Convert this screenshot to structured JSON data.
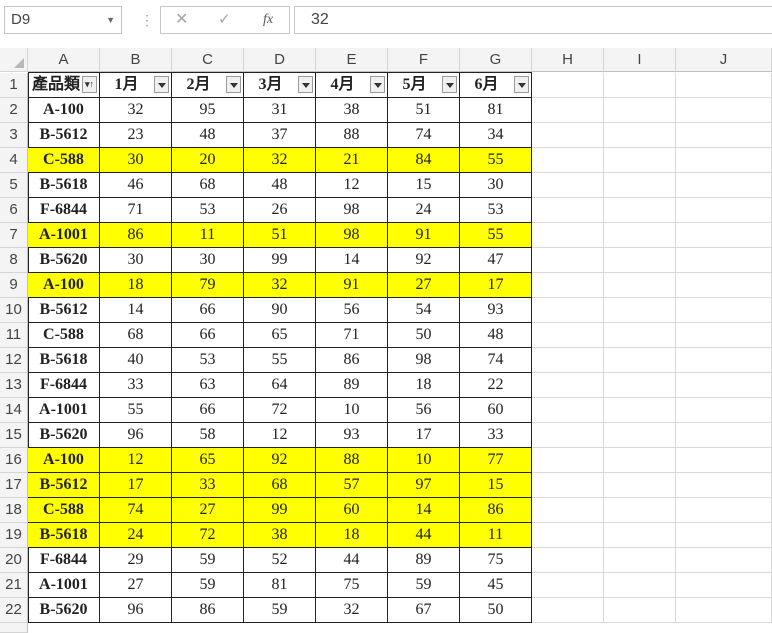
{
  "formula_bar": {
    "name_box": "D9",
    "cancel_icon": "✕",
    "enter_icon": "✓",
    "fx_icon": "fx",
    "formula_value": "32"
  },
  "columns": [
    "A",
    "B",
    "C",
    "D",
    "E",
    "F",
    "G",
    "H",
    "I",
    "J"
  ],
  "header_row": [
    "產品類",
    "1月",
    "2月",
    "3月",
    "4月",
    "5月",
    "6月"
  ],
  "rows": [
    {
      "num": "2",
      "cells": [
        "A-100",
        "32",
        "95",
        "31",
        "38",
        "51",
        "81"
      ],
      "highlight": false
    },
    {
      "num": "3",
      "cells": [
        "B-5612",
        "23",
        "48",
        "37",
        "88",
        "74",
        "34"
      ],
      "highlight": false
    },
    {
      "num": "4",
      "cells": [
        "C-588",
        "30",
        "20",
        "32",
        "21",
        "84",
        "55"
      ],
      "highlight": true
    },
    {
      "num": "5",
      "cells": [
        "B-5618",
        "46",
        "68",
        "48",
        "12",
        "15",
        "30"
      ],
      "highlight": false
    },
    {
      "num": "6",
      "cells": [
        "F-6844",
        "71",
        "53",
        "26",
        "98",
        "24",
        "53"
      ],
      "highlight": false
    },
    {
      "num": "7",
      "cells": [
        "A-1001",
        "86",
        "11",
        "51",
        "98",
        "91",
        "55"
      ],
      "highlight": true
    },
    {
      "num": "8",
      "cells": [
        "B-5620",
        "30",
        "30",
        "99",
        "14",
        "92",
        "47"
      ],
      "highlight": false
    },
    {
      "num": "9",
      "cells": [
        "A-100",
        "18",
        "79",
        "32",
        "91",
        "27",
        "17"
      ],
      "highlight": true
    },
    {
      "num": "10",
      "cells": [
        "B-5612",
        "14",
        "66",
        "90",
        "56",
        "54",
        "93"
      ],
      "highlight": false
    },
    {
      "num": "11",
      "cells": [
        "C-588",
        "68",
        "66",
        "65",
        "71",
        "50",
        "48"
      ],
      "highlight": false
    },
    {
      "num": "12",
      "cells": [
        "B-5618",
        "40",
        "53",
        "55",
        "86",
        "98",
        "74"
      ],
      "highlight": false
    },
    {
      "num": "13",
      "cells": [
        "F-6844",
        "33",
        "63",
        "64",
        "89",
        "18",
        "22"
      ],
      "highlight": false
    },
    {
      "num": "14",
      "cells": [
        "A-1001",
        "55",
        "66",
        "72",
        "10",
        "56",
        "60"
      ],
      "highlight": false
    },
    {
      "num": "15",
      "cells": [
        "B-5620",
        "96",
        "58",
        "12",
        "93",
        "17",
        "33"
      ],
      "highlight": false
    },
    {
      "num": "16",
      "cells": [
        "A-100",
        "12",
        "65",
        "92",
        "88",
        "10",
        "77"
      ],
      "highlight": true
    },
    {
      "num": "17",
      "cells": [
        "B-5612",
        "17",
        "33",
        "68",
        "57",
        "97",
        "15"
      ],
      "highlight": true
    },
    {
      "num": "18",
      "cells": [
        "C-588",
        "74",
        "27",
        "99",
        "60",
        "14",
        "86"
      ],
      "highlight": true
    },
    {
      "num": "19",
      "cells": [
        "B-5618",
        "24",
        "72",
        "38",
        "18",
        "44",
        "11"
      ],
      "highlight": true
    },
    {
      "num": "20",
      "cells": [
        "F-6844",
        "29",
        "59",
        "52",
        "44",
        "89",
        "75"
      ],
      "highlight": false
    },
    {
      "num": "21",
      "cells": [
        "A-1001",
        "27",
        "59",
        "81",
        "75",
        "59",
        "45"
      ],
      "highlight": false
    },
    {
      "num": "22",
      "cells": [
        "B-5620",
        "96",
        "86",
        "59",
        "32",
        "67",
        "50"
      ],
      "highlight": false
    }
  ],
  "header_row_num": "1",
  "sort_icon": "▾↑",
  "highlight_color": "#ffff00"
}
